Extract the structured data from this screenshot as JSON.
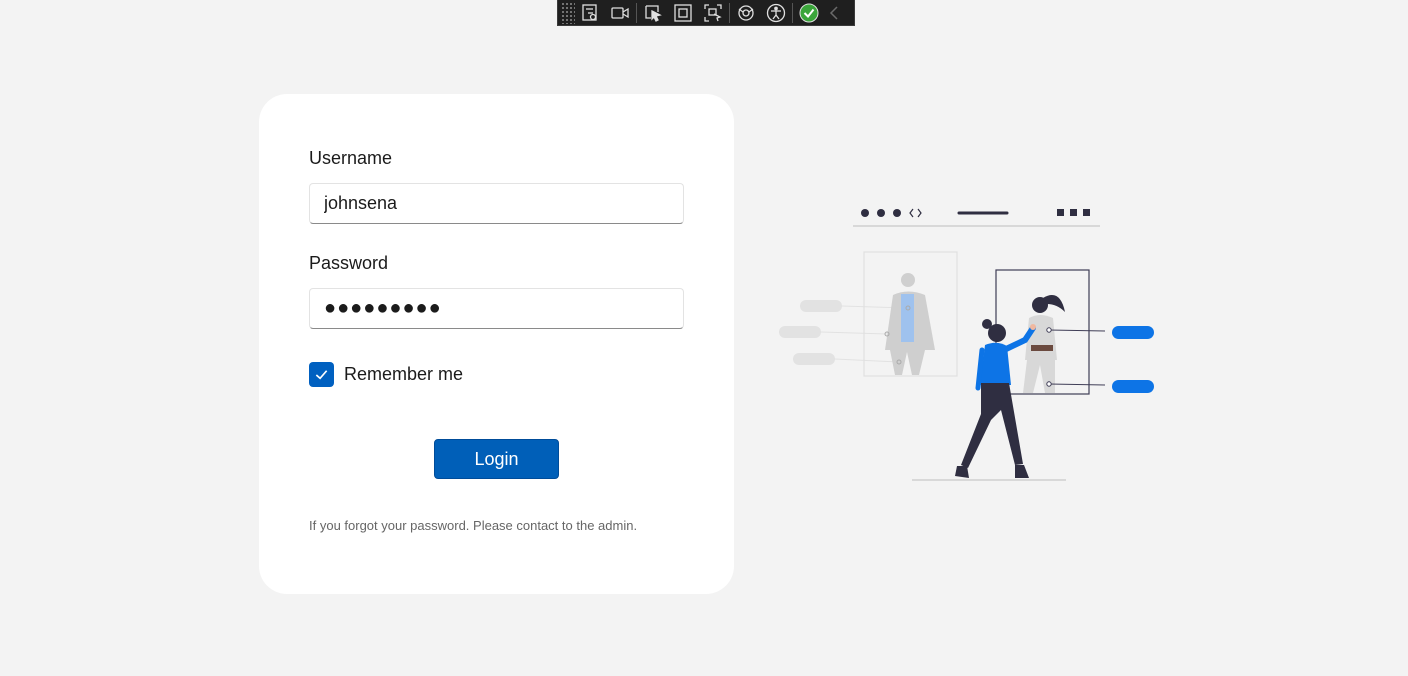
{
  "toolbar": {
    "buttons": [
      {
        "icon": "live-visual-tree-icon"
      },
      {
        "icon": "record-icon"
      },
      {
        "icon": "select-element-icon"
      },
      {
        "icon": "display-layout-adorners-icon"
      },
      {
        "icon": "track-focus-icon"
      },
      {
        "icon": "hot-reload-icon"
      },
      {
        "icon": "accessibility-icon"
      },
      {
        "icon": "ok-status-icon"
      },
      {
        "icon": "collapse-chevron-icon"
      }
    ]
  },
  "login_form": {
    "username_label": "Username",
    "username_value": "johnsena",
    "password_label": "Password",
    "password_value": "●●●●●●●●●",
    "remember_label": "Remember me",
    "remember_checked": true,
    "login_button": "Login",
    "hint": "If you forgot your password. Please contact to the admin."
  },
  "colors": {
    "accent": "#005fb8",
    "illustration_accent": "#0d74e6",
    "illustration_dark": "#2f2e41",
    "background": "#f3f3f3"
  }
}
